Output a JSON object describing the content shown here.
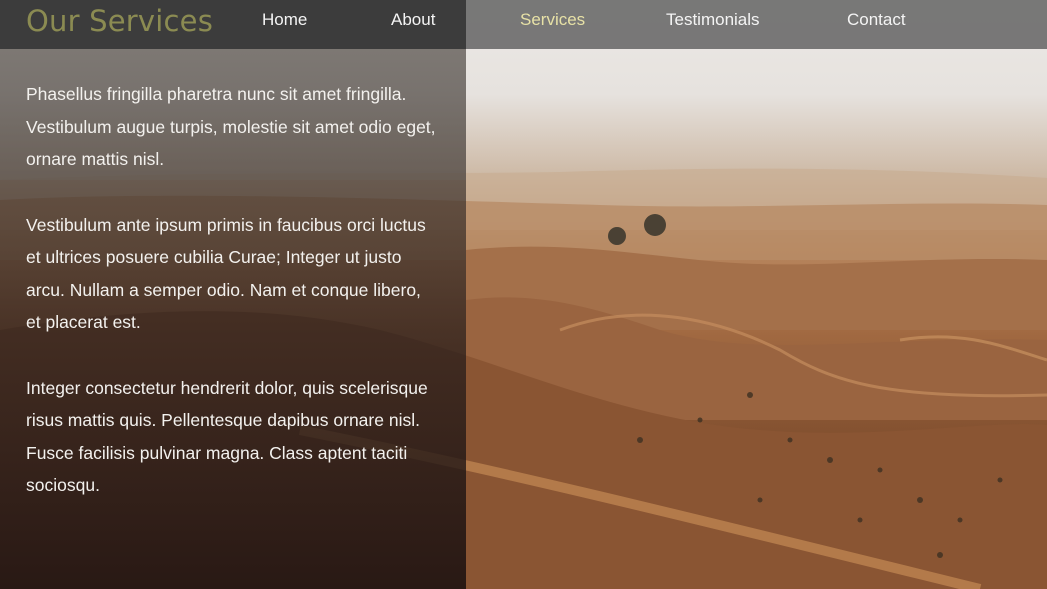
{
  "header": {
    "title": "Our Services"
  },
  "nav": {
    "items": [
      {
        "label": "Home",
        "active": false
      },
      {
        "label": "About",
        "active": false
      },
      {
        "label": "Services",
        "active": true
      },
      {
        "label": "Testimonials",
        "active": false
      },
      {
        "label": "Contact",
        "active": false
      }
    ]
  },
  "main": {
    "paragraphs": [
      "Phasellus fringilla pharetra nunc sit amet fringilla. Vestibulum augue turpis, molestie sit amet odio eget, ornare mattis nisl.",
      "Vestibulum ante ipsum primis in faucibus orci luctus et ultrices posuere cubilia Curae; Integer ut justo arcu. Nullam a semper odio. Nam et conque libero, et placerat est.",
      "Integer consectetur hendrerit dolor, quis scelerisque risus mattis quis. Pellentesque dapibus ornare nisl. Fusce facilisis pulvinar magna. Class aptent taciti sociosqu."
    ]
  },
  "colors": {
    "logo": "#8b8b52",
    "nav_active": "#e7e1a6",
    "nav_text": "#f4f4f4"
  }
}
